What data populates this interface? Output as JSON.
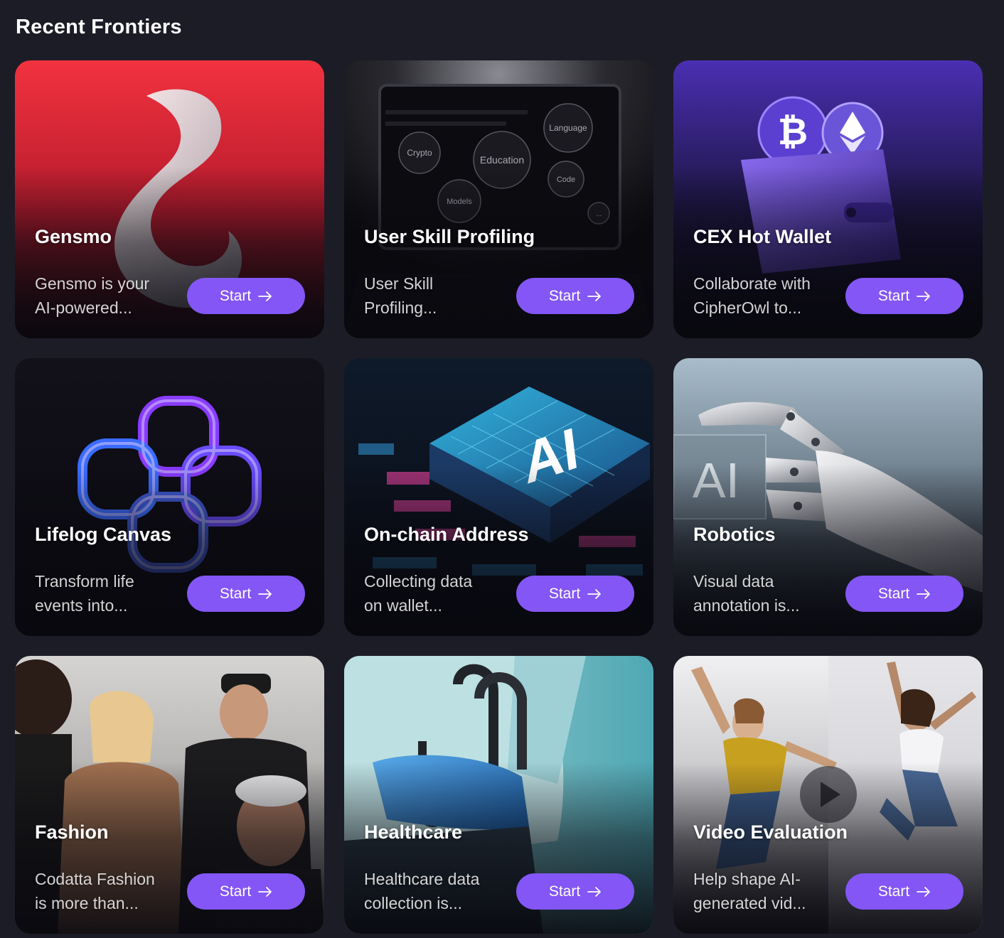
{
  "section": {
    "title": "Recent Frontiers"
  },
  "button_label": "Start",
  "accent_color": "#8356f5",
  "cards": [
    {
      "title": "Gensmo",
      "desc_line1": "Gensmo is your",
      "desc_line2": "AI-powered...",
      "image": "gensmo-logo"
    },
    {
      "title": "User Skill Profiling",
      "desc_line1": "User Skill",
      "desc_line2": "Profiling...",
      "image": "laptop-skill-bubbles",
      "bubbles": [
        "Crypto",
        "Education",
        "Language",
        "Code",
        "Models",
        "..."
      ]
    },
    {
      "title": "CEX Hot Wallet",
      "desc_line1": "Collaborate with",
      "desc_line2": "CipherOwl to...",
      "image": "crypto-wallet"
    },
    {
      "title": "Lifelog Canvas",
      "desc_line1": "Transform life",
      "desc_line2": "events into...",
      "image": "neon-knot"
    },
    {
      "title": "On-chain Address",
      "desc_line1": "Collecting data",
      "desc_line2": "on wallet...",
      "image": "ai-chip",
      "chip_text": "AI"
    },
    {
      "title": "Robotics",
      "desc_line1": "Visual data",
      "desc_line2": "annotation is...",
      "image": "robot-hand",
      "chip_text": "AI"
    },
    {
      "title": "Fashion",
      "desc_line1": "Codatta Fashion",
      "desc_line2": "is more than...",
      "image": "fashion-group"
    },
    {
      "title": "Healthcare",
      "desc_line1": "Healthcare data",
      "desc_line2": "collection is...",
      "image": "stethoscope"
    },
    {
      "title": "Video Evaluation",
      "desc_line1": "Help shape AI-",
      "desc_line2": "generated vid...",
      "image": "dancers-video"
    }
  ]
}
